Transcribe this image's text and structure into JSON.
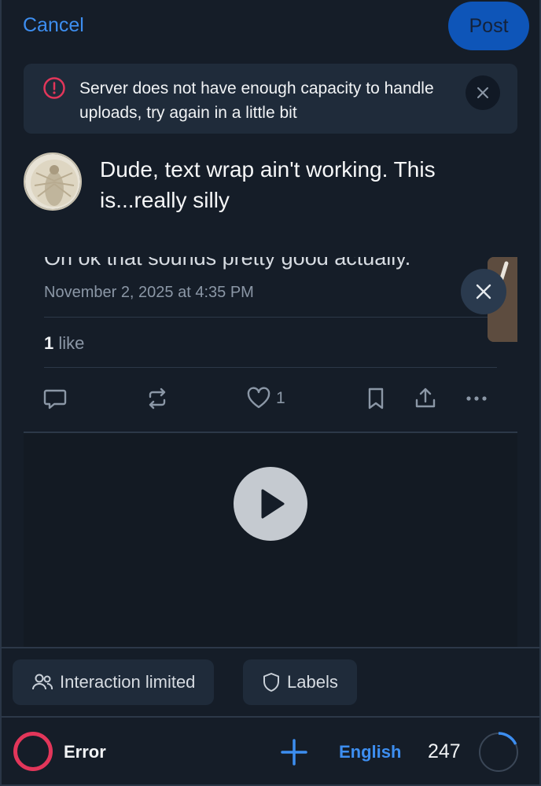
{
  "header": {
    "cancel_label": "Cancel",
    "post_label": "Post"
  },
  "banner": {
    "message": "Server does not have enough capacity to handle uploads, try again in a little bit",
    "icon": "alert-circle-icon",
    "close_icon": "close-icon"
  },
  "composer": {
    "text": "Dude, text wrap ain't working. This is...really silly"
  },
  "embed": {
    "partial_text": "Oh ok that sounds pretty good actually.",
    "date": "November 2, 2025 at 4:35 PM",
    "likes_count": "1",
    "likes_label": "like",
    "heart_count": "1"
  },
  "footer": {
    "interaction_label": "Interaction limited",
    "labels_label": "Labels",
    "error_label": "Error",
    "language": "English",
    "char_count": "247",
    "char_progress": 0.18
  },
  "colors": {
    "background": "#151d28",
    "accent": "#3d8ef0",
    "error": "#e2365a",
    "post_button": "#0e55b8"
  }
}
